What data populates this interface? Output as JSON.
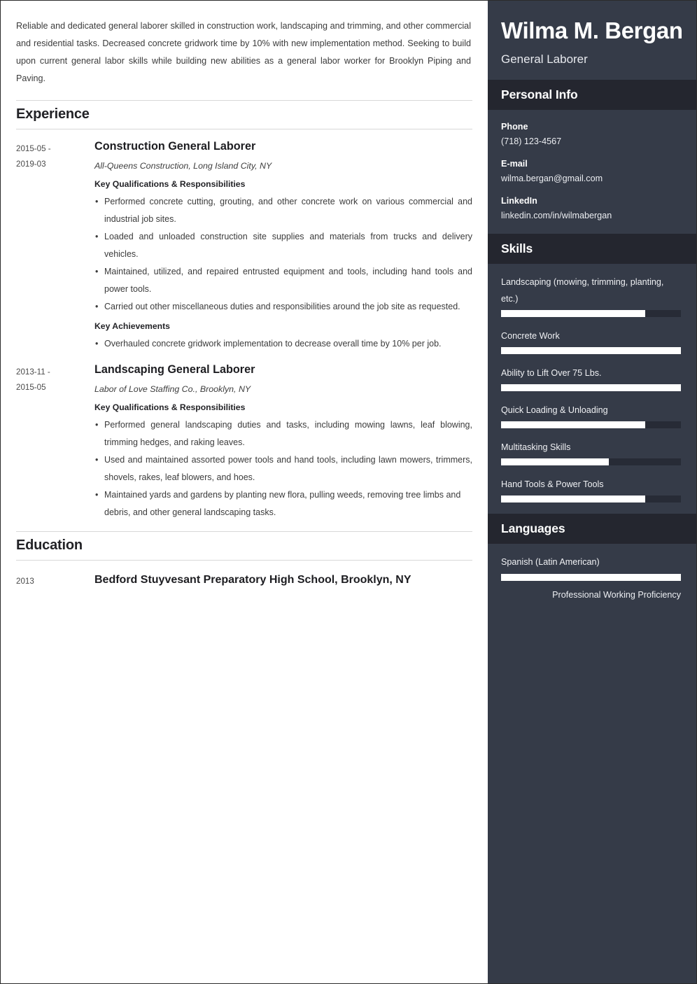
{
  "main": {
    "summary": "Reliable and dedicated general laborer skilled in construction work, landscaping and trimming, and other commercial and residential tasks. Decreased concrete gridwork time by 10% with new implementation method. Seeking to build upon current general labor skills while building new abilities as a general labor worker for Brooklyn Piping and Paving.",
    "experience_heading": "Experience",
    "education_heading": "Education",
    "experience": [
      {
        "date_start": "2015-05 -",
        "date_end": "2019-03",
        "title": "Construction General Laborer",
        "organization": "All-Queens Construction, Long Island City, NY",
        "qualifications_heading": "Key Qualifications & Responsibilities",
        "qualifications": [
          "Performed concrete cutting, grouting, and other concrete work on various commercial and industrial job sites.",
          "Loaded and unloaded construction site supplies and materials from trucks and delivery vehicles.",
          "Maintained, utilized, and repaired entrusted equipment and tools, including hand tools and power tools.",
          "Carried out other miscellaneous duties and responsibilities around the job site as requested."
        ],
        "achievements_heading": "Key Achievements",
        "achievements": [
          "Overhauled concrete gridwork implementation to decrease overall time by 10% per job."
        ]
      },
      {
        "date_start": "2013-11 -",
        "date_end": "2015-05",
        "title": "Landscaping General Laborer",
        "organization": "Labor of Love Staffing Co., Brooklyn, NY",
        "qualifications_heading": "Key Qualifications & Responsibilities",
        "qualifications": [
          "Performed general landscaping duties and tasks, including mowing lawns, leaf blowing, trimming hedges, and raking leaves.",
          "Used and maintained assorted power tools and hand tools, including lawn mowers, trimmers, shovels, rakes, leaf blowers, and hoes.",
          "Maintained yards and gardens by planting new flora, pulling weeds, removing tree limbs and debris, and other general landscaping tasks."
        ],
        "achievements_heading": "",
        "achievements": []
      }
    ],
    "education": [
      {
        "date": "2013",
        "school": "Bedford Stuyvesant Preparatory High School, Brooklyn, NY"
      }
    ]
  },
  "sidebar": {
    "name": "Wilma M. Bergan",
    "role": "General Laborer",
    "personal_info_heading": "Personal Info",
    "contacts": [
      {
        "label": "Phone",
        "value": "(718) 123-4567"
      },
      {
        "label": "E-mail",
        "value": "wilma.bergan@gmail.com"
      },
      {
        "label": "LinkedIn",
        "value": "linkedin.com/in/wilmabergan"
      }
    ],
    "skills_heading": "Skills",
    "skills": [
      {
        "name": "Landscaping (mowing, trimming, planting, etc.)",
        "level": 80
      },
      {
        "name": "Concrete Work",
        "level": 100
      },
      {
        "name": "Ability to Lift Over 75 Lbs.",
        "level": 100
      },
      {
        "name": "Quick Loading & Unloading",
        "level": 80
      },
      {
        "name": "Multitasking Skills",
        "level": 60
      },
      {
        "name": "Hand Tools & Power Tools",
        "level": 80
      }
    ],
    "languages_heading": "Languages",
    "languages": [
      {
        "name": "Spanish (Latin American)",
        "level": 100,
        "proficiency": "Professional Working Proficiency"
      }
    ]
  },
  "colors": {
    "sidebar_bg": "#353b48",
    "sidebar_band_bg": "#24262f",
    "bar_fill": "#ffffff",
    "bar_track": "#272b36",
    "page_bg": "#ffffff",
    "text": "#3b3b3b"
  }
}
